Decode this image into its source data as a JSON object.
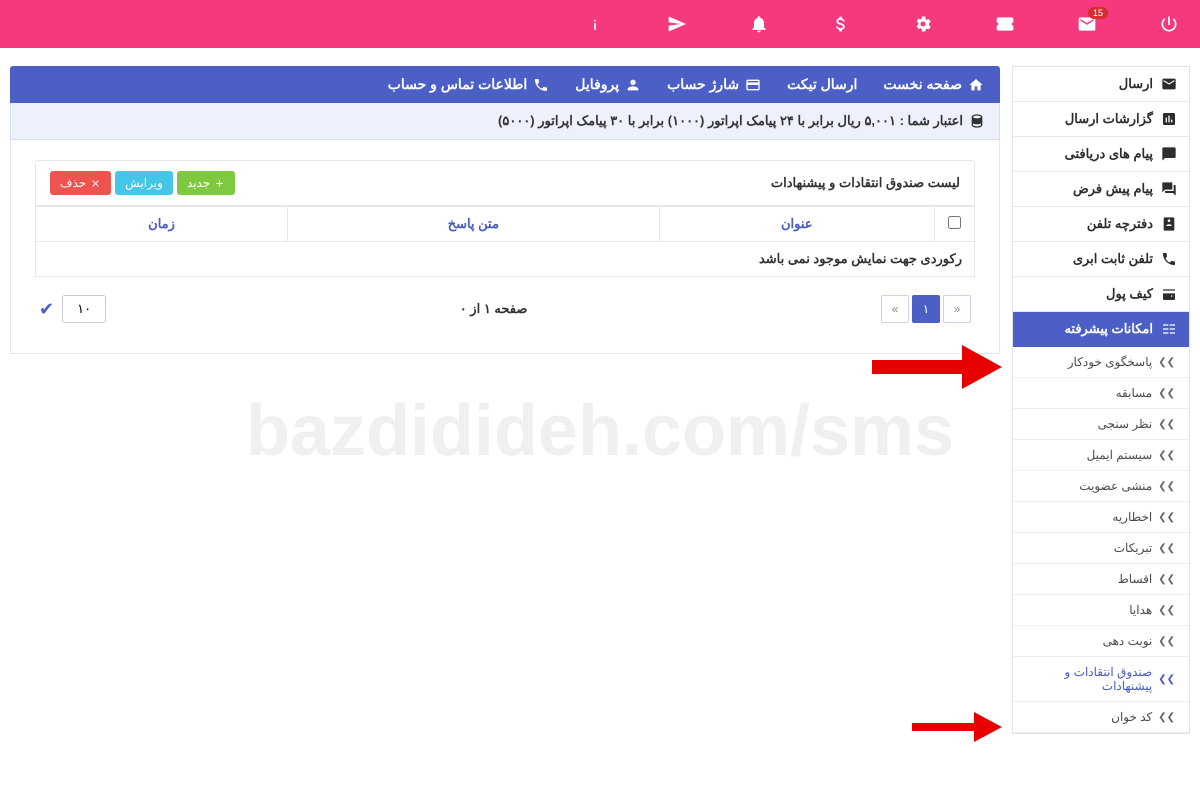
{
  "topbar": {
    "badge": "15"
  },
  "sidebar": {
    "send": "ارسال",
    "reports": "گزارشات ارسال",
    "inbox": "پیام های دریافتی",
    "default": "پیام پیش فرض",
    "phonebook": "دفترچه تلفن",
    "cloudphone": "تلفن ثابت ابری",
    "wallet": "کیف پول",
    "advanced": "امکانات پیشرفته",
    "subs": {
      "autoresponder": "پاسخگوی خودکار",
      "contest": "مسابقه",
      "poll": "نظر سنجی",
      "email": "سیستم ایمیل",
      "secretary": "منشی عضویت",
      "notice": "اخطاریه",
      "greeting": "تبریکات",
      "installments": "اقساط",
      "gifts": "هدایا",
      "queue": "نوبت دهی",
      "suggestion": "صندوق انتقادات و پیشنهادات",
      "codereader": "کد خوان"
    }
  },
  "panelnav": {
    "home": "صفحه نخست",
    "ticket": "ارسال تیکت",
    "charge": "شارژ حساب",
    "profile": "پروفایل",
    "contact": "اطلاعات تماس و حساب"
  },
  "credit": "اعتبار شما : ۵,۰۰۱ ریال برابر با ۲۴ پیامک اپراتور (۱۰۰۰) برابر با ۳۰ پیامک اپراتور (۵۰۰۰)",
  "list": {
    "title": "لیست صندوق انتقادات و پیشنهادات",
    "btn_new": "جدید",
    "btn_edit": "ویرایش",
    "btn_delete": "حذف",
    "col_title": "عنوان",
    "col_answer": "متن پاسخ",
    "col_time": "زمان",
    "empty": "رکوردی جهت نمایش موجود نمی باشد"
  },
  "pager": {
    "current": "۱",
    "info": "صفحه ۱ از ۰",
    "size": "۱۰"
  },
  "watermark": "bazdidideh.com/sms"
}
